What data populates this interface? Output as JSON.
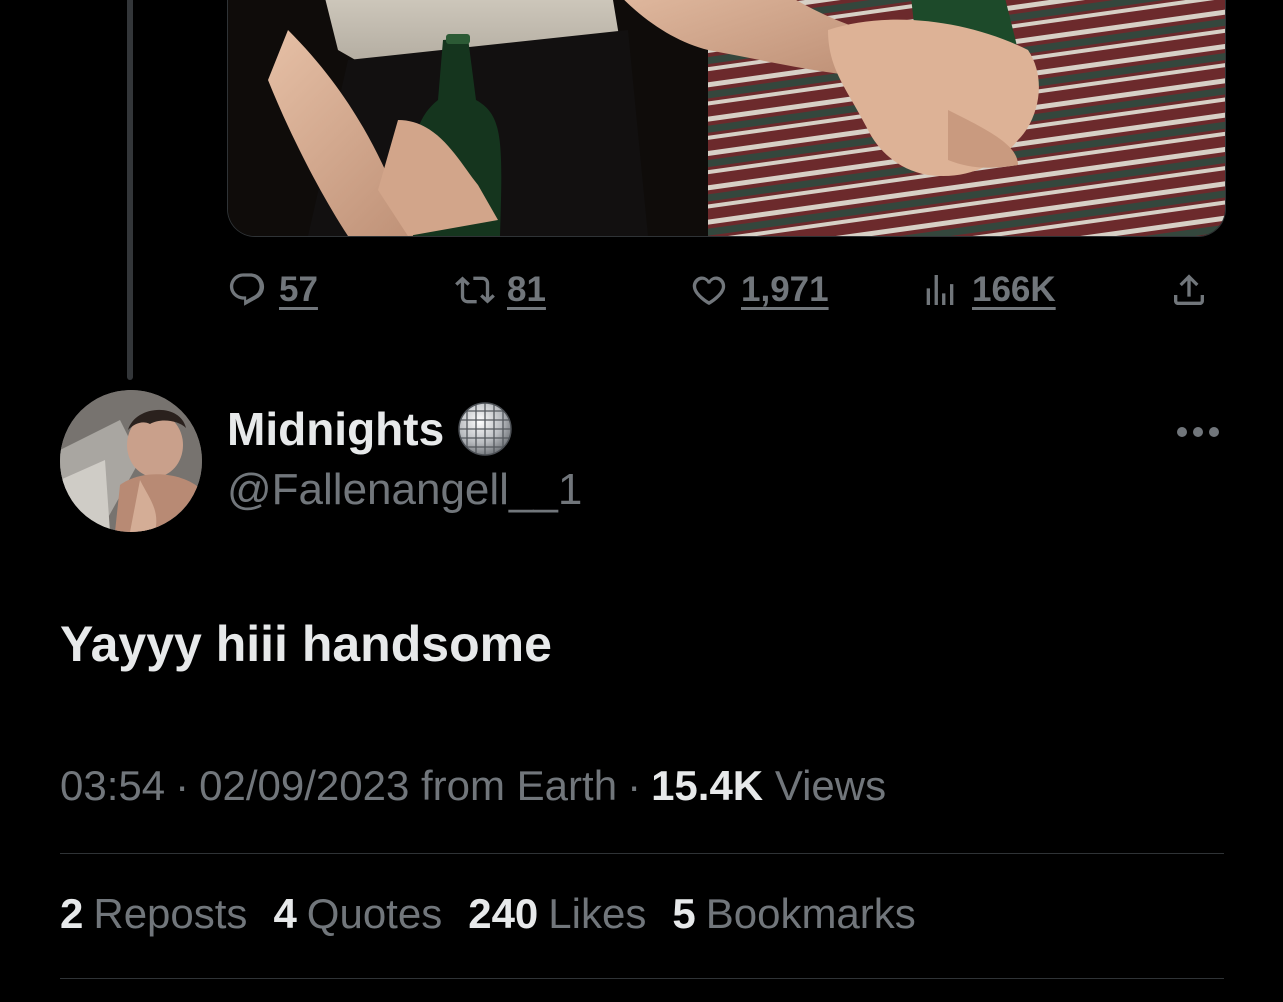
{
  "parent_tweet": {
    "actions": {
      "replies": "57",
      "reposts": "81",
      "likes": "1,971",
      "views": "166K"
    }
  },
  "tweet": {
    "display_name": "Midnights",
    "name_emoji": "disco-ball",
    "handle": "@Fallenangell__1",
    "text": "Yayyy hiii handsome",
    "meta": {
      "time": "03:54",
      "separator": "·",
      "date": "02/09/2023",
      "from": "from Earth",
      "views_count": "15.4K",
      "views_label": "Views"
    },
    "stats": [
      {
        "count": "2",
        "label": "Reposts"
      },
      {
        "count": "4",
        "label": "Quotes"
      },
      {
        "count": "240",
        "label": "Likes"
      },
      {
        "count": "5",
        "label": "Bookmarks"
      }
    ]
  },
  "colors": {
    "background": "#000000",
    "primary_text": "#e7e9ea",
    "secondary_text": "#71767b",
    "divider": "#2f3336"
  },
  "icons": [
    "reply-icon",
    "repost-icon",
    "like-icon",
    "views-icon",
    "share-icon",
    "more-icon",
    "disco-ball-icon"
  ]
}
